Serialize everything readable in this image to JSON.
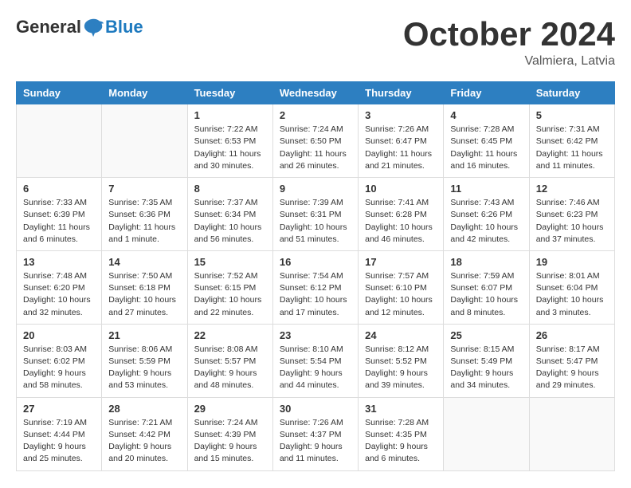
{
  "header": {
    "logo_general": "General",
    "logo_blue": "Blue",
    "month_title": "October 2024",
    "location": "Valmiera, Latvia"
  },
  "weekdays": [
    "Sunday",
    "Monday",
    "Tuesday",
    "Wednesday",
    "Thursday",
    "Friday",
    "Saturday"
  ],
  "weeks": [
    [
      {
        "day": "",
        "info": ""
      },
      {
        "day": "",
        "info": ""
      },
      {
        "day": "1",
        "info": "Sunrise: 7:22 AM\nSunset: 6:53 PM\nDaylight: 11 hours\nand 30 minutes."
      },
      {
        "day": "2",
        "info": "Sunrise: 7:24 AM\nSunset: 6:50 PM\nDaylight: 11 hours\nand 26 minutes."
      },
      {
        "day": "3",
        "info": "Sunrise: 7:26 AM\nSunset: 6:47 PM\nDaylight: 11 hours\nand 21 minutes."
      },
      {
        "day": "4",
        "info": "Sunrise: 7:28 AM\nSunset: 6:45 PM\nDaylight: 11 hours\nand 16 minutes."
      },
      {
        "day": "5",
        "info": "Sunrise: 7:31 AM\nSunset: 6:42 PM\nDaylight: 11 hours\nand 11 minutes."
      }
    ],
    [
      {
        "day": "6",
        "info": "Sunrise: 7:33 AM\nSunset: 6:39 PM\nDaylight: 11 hours\nand 6 minutes."
      },
      {
        "day": "7",
        "info": "Sunrise: 7:35 AM\nSunset: 6:36 PM\nDaylight: 11 hours\nand 1 minute."
      },
      {
        "day": "8",
        "info": "Sunrise: 7:37 AM\nSunset: 6:34 PM\nDaylight: 10 hours\nand 56 minutes."
      },
      {
        "day": "9",
        "info": "Sunrise: 7:39 AM\nSunset: 6:31 PM\nDaylight: 10 hours\nand 51 minutes."
      },
      {
        "day": "10",
        "info": "Sunrise: 7:41 AM\nSunset: 6:28 PM\nDaylight: 10 hours\nand 46 minutes."
      },
      {
        "day": "11",
        "info": "Sunrise: 7:43 AM\nSunset: 6:26 PM\nDaylight: 10 hours\nand 42 minutes."
      },
      {
        "day": "12",
        "info": "Sunrise: 7:46 AM\nSunset: 6:23 PM\nDaylight: 10 hours\nand 37 minutes."
      }
    ],
    [
      {
        "day": "13",
        "info": "Sunrise: 7:48 AM\nSunset: 6:20 PM\nDaylight: 10 hours\nand 32 minutes."
      },
      {
        "day": "14",
        "info": "Sunrise: 7:50 AM\nSunset: 6:18 PM\nDaylight: 10 hours\nand 27 minutes."
      },
      {
        "day": "15",
        "info": "Sunrise: 7:52 AM\nSunset: 6:15 PM\nDaylight: 10 hours\nand 22 minutes."
      },
      {
        "day": "16",
        "info": "Sunrise: 7:54 AM\nSunset: 6:12 PM\nDaylight: 10 hours\nand 17 minutes."
      },
      {
        "day": "17",
        "info": "Sunrise: 7:57 AM\nSunset: 6:10 PM\nDaylight: 10 hours\nand 12 minutes."
      },
      {
        "day": "18",
        "info": "Sunrise: 7:59 AM\nSunset: 6:07 PM\nDaylight: 10 hours\nand 8 minutes."
      },
      {
        "day": "19",
        "info": "Sunrise: 8:01 AM\nSunset: 6:04 PM\nDaylight: 10 hours\nand 3 minutes."
      }
    ],
    [
      {
        "day": "20",
        "info": "Sunrise: 8:03 AM\nSunset: 6:02 PM\nDaylight: 9 hours\nand 58 minutes."
      },
      {
        "day": "21",
        "info": "Sunrise: 8:06 AM\nSunset: 5:59 PM\nDaylight: 9 hours\nand 53 minutes."
      },
      {
        "day": "22",
        "info": "Sunrise: 8:08 AM\nSunset: 5:57 PM\nDaylight: 9 hours\nand 48 minutes."
      },
      {
        "day": "23",
        "info": "Sunrise: 8:10 AM\nSunset: 5:54 PM\nDaylight: 9 hours\nand 44 minutes."
      },
      {
        "day": "24",
        "info": "Sunrise: 8:12 AM\nSunset: 5:52 PM\nDaylight: 9 hours\nand 39 minutes."
      },
      {
        "day": "25",
        "info": "Sunrise: 8:15 AM\nSunset: 5:49 PM\nDaylight: 9 hours\nand 34 minutes."
      },
      {
        "day": "26",
        "info": "Sunrise: 8:17 AM\nSunset: 5:47 PM\nDaylight: 9 hours\nand 29 minutes."
      }
    ],
    [
      {
        "day": "27",
        "info": "Sunrise: 7:19 AM\nSunset: 4:44 PM\nDaylight: 9 hours\nand 25 minutes."
      },
      {
        "day": "28",
        "info": "Sunrise: 7:21 AM\nSunset: 4:42 PM\nDaylight: 9 hours\nand 20 minutes."
      },
      {
        "day": "29",
        "info": "Sunrise: 7:24 AM\nSunset: 4:39 PM\nDaylight: 9 hours\nand 15 minutes."
      },
      {
        "day": "30",
        "info": "Sunrise: 7:26 AM\nSunset: 4:37 PM\nDaylight: 9 hours\nand 11 minutes."
      },
      {
        "day": "31",
        "info": "Sunrise: 7:28 AM\nSunset: 4:35 PM\nDaylight: 9 hours\nand 6 minutes."
      },
      {
        "day": "",
        "info": ""
      },
      {
        "day": "",
        "info": ""
      }
    ]
  ]
}
